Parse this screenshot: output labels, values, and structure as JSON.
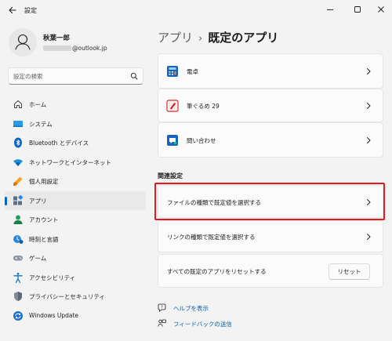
{
  "window": {
    "title": "設定",
    "controls": [
      "minimize-icon",
      "maximize-icon",
      "close-icon"
    ]
  },
  "profile": {
    "name": "秋葉一郎",
    "email_suffix": "@outlook.jp"
  },
  "search": {
    "placeholder": "設定の検索",
    "value": ""
  },
  "sidebar": {
    "items": [
      {
        "label": "ホーム",
        "icon": "home-icon",
        "selected": false
      },
      {
        "label": "システム",
        "icon": "system-icon",
        "selected": false
      },
      {
        "label": "Bluetooth とデバイス",
        "icon": "bluetooth-icon",
        "selected": false
      },
      {
        "label": "ネットワークとインターネット",
        "icon": "network-icon",
        "selected": false
      },
      {
        "label": "個人用設定",
        "icon": "personalization-icon",
        "selected": false
      },
      {
        "label": "アプリ",
        "icon": "apps-icon",
        "selected": true
      },
      {
        "label": "アカウント",
        "icon": "account-icon",
        "selected": false
      },
      {
        "label": "時刻と言語",
        "icon": "time-language-icon",
        "selected": false
      },
      {
        "label": "ゲーム",
        "icon": "gaming-icon",
        "selected": false
      },
      {
        "label": "アクセシビリティ",
        "icon": "accessibility-icon",
        "selected": false
      },
      {
        "label": "プライバシーとセキュリティ",
        "icon": "privacy-icon",
        "selected": false
      },
      {
        "label": "Windows Update",
        "icon": "windows-update-icon",
        "selected": false
      }
    ]
  },
  "main": {
    "breadcrumb_parent": "アプリ",
    "breadcrumb_separator": "›",
    "breadcrumb_current": "既定のアプリ",
    "apps": [
      {
        "label": "電卓",
        "icon": "calculator-icon"
      },
      {
        "label": "筆ぐるめ 29",
        "icon": "fudegurume-icon"
      },
      {
        "label": "問い合わせ",
        "icon": "contact-support-icon"
      }
    ],
    "related_heading": "関連設定",
    "related": [
      {
        "label": "ファイルの種類で既定値を選択する",
        "highlighted": true
      },
      {
        "label": "リンクの種類で既定値を選択する",
        "highlighted": false
      }
    ],
    "reset_label": "すべての既定のアプリをリセットする",
    "reset_button": "リセット",
    "help_link": "ヘルプを表示",
    "feedback_link": "フィードバックの送信"
  },
  "colors": {
    "accent": "#0067c0",
    "highlight": "#e8171e",
    "background": "#f3f3f3",
    "card": "#fbfbfb"
  }
}
